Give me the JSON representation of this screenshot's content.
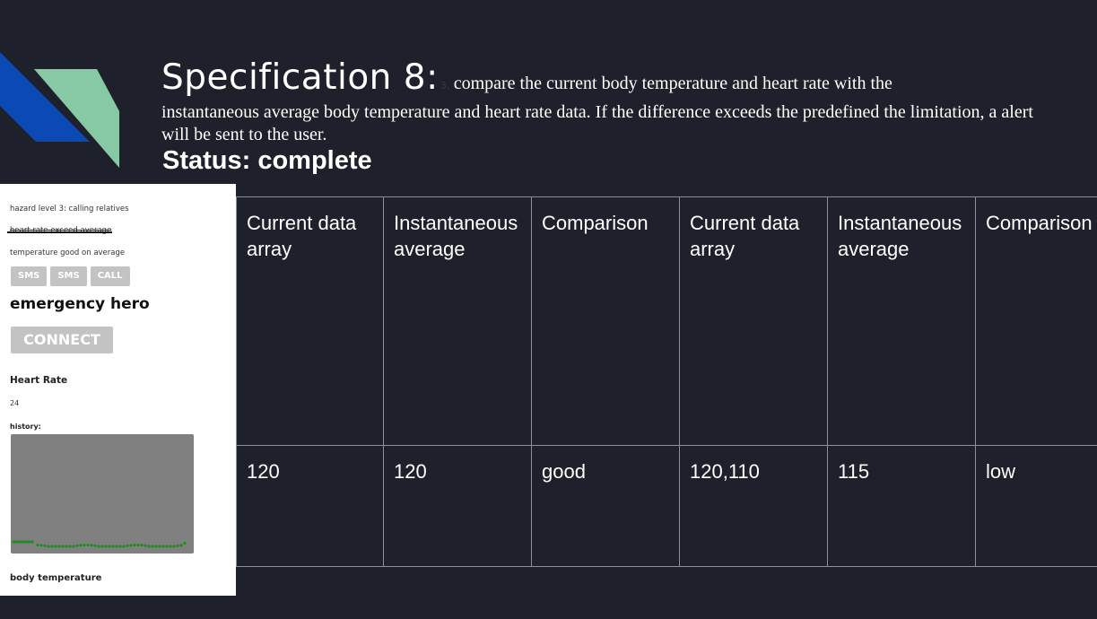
{
  "slide": {
    "title": "Specification 8:",
    "spec_number": "3.",
    "description_first": "compare the current body temperature and heart rate with the",
    "description_rest": "instantaneous average body temperature and heart rate data. If the difference exceeds the predefined the limitation, a alert will be sent to the user.",
    "status": "Status: complete"
  },
  "app": {
    "hazard_text": "hazard level 3: calling relatives",
    "heart_rate_alert": "heart rate exceed average",
    "temperature_status": "temperature good on average",
    "buttons": [
      "SMS",
      "SMS",
      "CALL"
    ],
    "title": "emergency hero",
    "connect_label": "CONNECT",
    "heart_rate_label": "Heart Rate",
    "heart_rate_value": "24",
    "history_label": "history:",
    "body_temperature_label": "body temperature"
  },
  "table": {
    "headers": [
      "Current data array",
      "Instantaneous average",
      "Comparison",
      "Current data array",
      "Instantaneous average",
      "Comparison"
    ],
    "rows": [
      [
        "120",
        "120",
        "good",
        "120,110",
        "115",
        "low"
      ]
    ]
  },
  "colors": {
    "background": "#1e212b",
    "logo_blue": "#0b49b5",
    "logo_green": "#88c9a5",
    "grid_line": "#8b8f99",
    "graph_bg": "#808080",
    "graph_points": "#1f8a1f",
    "button_grey": "#c3c3c3"
  }
}
